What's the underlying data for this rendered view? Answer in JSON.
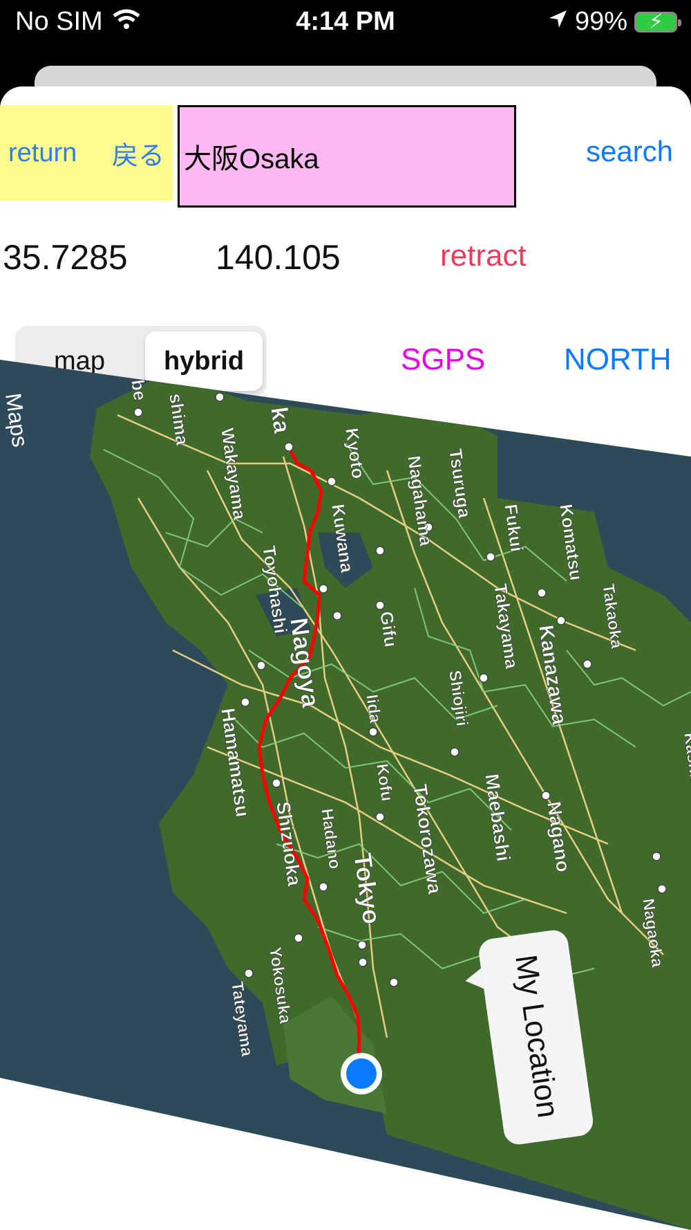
{
  "status_bar": {
    "carrier": "No SIM",
    "time": "4:14 PM",
    "battery": "99%",
    "icons": [
      "wifi-icon",
      "location-arrow-icon",
      "battery-charging-icon"
    ]
  },
  "controls": {
    "return_label": "return",
    "return_label_jp": "戻る",
    "search_value": "大阪Osaka",
    "search_button": "search",
    "latitude": "35.7285",
    "longitude": "140.105",
    "retract_label": "retract",
    "map_type_options": [
      "map",
      "hybrid"
    ],
    "map_type_selected": "hybrid",
    "sgps_label": "SGPS",
    "north_label": "NORTH"
  },
  "map": {
    "attribution": "Maps",
    "callout": "My Location",
    "city_labels": [
      "Kyoto",
      "Nagahama",
      "Tsuruga",
      "Wakayama",
      "Kuwana",
      "Fukui",
      "Komatsu",
      "Toyohashi",
      "Gifu",
      "Takayama",
      "Kanazawa",
      "Takaoka",
      "Nagoya",
      "Shiojiri",
      "Iida",
      "Hamamatsu",
      "Kofu",
      "Tokorozawa",
      "Maebashi",
      "Nagano",
      "Shizuoka",
      "Hadano",
      "Tokyo",
      "Yokosuka",
      "Tateyama",
      "Kashiwazaki",
      "Nagaoka",
      "shima",
      "be",
      "ka"
    ],
    "colors": {
      "route": "#ff0000",
      "roads_major": "#f2d488",
      "roads_minor": "#8ad17a",
      "land": "#3f6a2c",
      "water": "#2c4a58",
      "user_location": "#0a7aff"
    }
  }
}
